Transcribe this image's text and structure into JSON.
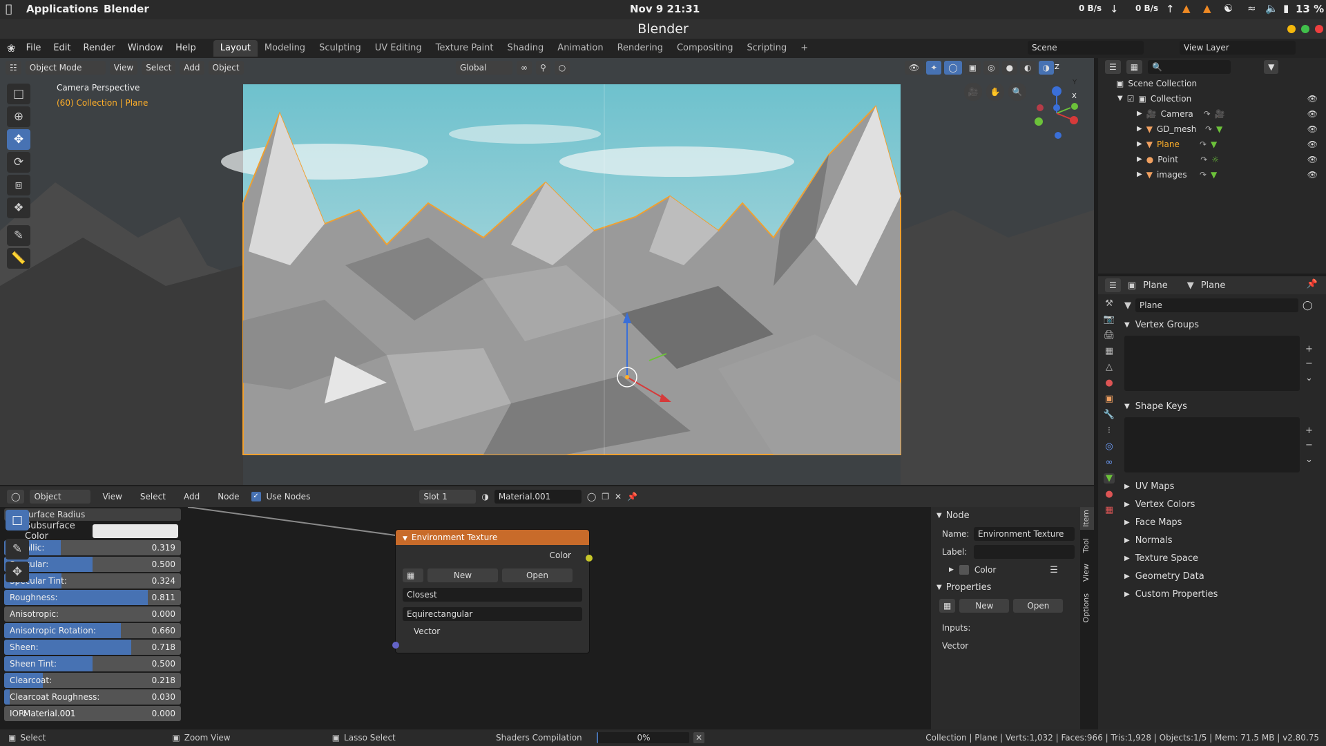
{
  "system": {
    "apps_label": "Applications",
    "app_name": "Blender",
    "datetime": "Nov 9  21:31",
    "net_down": "0 B/s",
    "net_up": "0 B/s",
    "battery": "13 %"
  },
  "window": {
    "title": "Blender"
  },
  "menu": {
    "items": [
      "File",
      "Edit",
      "Render",
      "Window",
      "Help"
    ],
    "workspaces": [
      "Layout",
      "Modeling",
      "Sculpting",
      "UV Editing",
      "Texture Paint",
      "Shading",
      "Animation",
      "Rendering",
      "Compositing",
      "Scripting"
    ],
    "active_workspace": "Layout",
    "add_tab": "+",
    "scene": "Scene",
    "view_layer": "View Layer"
  },
  "viewport": {
    "mode": "Object Mode",
    "menus": [
      "View",
      "Select",
      "Add",
      "Object"
    ],
    "orientation": "Global",
    "camera_label": "Camera Perspective",
    "collection_label": "(60) Collection | Plane",
    "gizmo": {
      "x": "X",
      "y": "Y",
      "z": "Z"
    }
  },
  "outliner": {
    "root": "Scene Collection",
    "collection": "Collection",
    "items": [
      {
        "name": "Camera",
        "active": false
      },
      {
        "name": "GD_mesh",
        "active": false
      },
      {
        "name": "Plane",
        "active": true
      },
      {
        "name": "Point",
        "active": false
      },
      {
        "name": "images",
        "active": false
      }
    ]
  },
  "properties": {
    "header_object": "Plane",
    "header_data": "Plane",
    "data_name": "Plane",
    "sections": {
      "vertex_groups": "Vertex Groups",
      "shape_keys": "Shape Keys"
    },
    "collapsed": [
      "UV Maps",
      "Vertex Colors",
      "Face Maps",
      "Normals",
      "Texture Space",
      "Geometry Data",
      "Custom Properties"
    ]
  },
  "node_editor": {
    "object_type": "Object",
    "menus": [
      "View",
      "Select",
      "Add",
      "Node"
    ],
    "use_nodes": "Use Nodes",
    "slot": "Slot 1",
    "material": "Material.001",
    "subsurface_radius": "Subsurface Radius",
    "subsurface_color": "Subsurface Color",
    "sliders": [
      {
        "label": "Metallic:",
        "value": "0.319",
        "frac": 0.319
      },
      {
        "label": "Specular:",
        "value": "0.500",
        "frac": 0.5
      },
      {
        "label": "Specular Tint:",
        "value": "0.324",
        "frac": 0.324
      },
      {
        "label": "Roughness:",
        "value": "0.811",
        "frac": 0.811
      },
      {
        "label": "Anisotropic:",
        "value": "0.000",
        "frac": 0
      },
      {
        "label": "Anisotropic Rotation:",
        "value": "0.660",
        "frac": 0.66
      },
      {
        "label": "Sheen:",
        "value": "0.718",
        "frac": 0.718
      },
      {
        "label": "Sheen Tint:",
        "value": "0.500",
        "frac": 0.5
      },
      {
        "label": "Clearcoat:",
        "value": "0.218",
        "frac": 0.218
      },
      {
        "label": "Clearcoat Roughness:",
        "value": "0.030",
        "frac": 0.03
      },
      {
        "label": "IOR:",
        "value": "0.000",
        "frac": 0
      }
    ],
    "node_label_overlay": "Material.001",
    "env_node": {
      "title": "Environment Texture",
      "output": "Color",
      "new": "New",
      "open": "Open",
      "interpolation": "Closest",
      "projection": "Equirectangular",
      "input": "Vector"
    },
    "sidebar": {
      "node_section": "Node",
      "name_label": "Name:",
      "name_value": "Environment Texture",
      "label_label": "Label:",
      "color_label": "Color",
      "properties_section": "Properties",
      "new": "New",
      "open": "Open",
      "inputs": "Inputs:",
      "vector": "Vector",
      "tabs": [
        "Item",
        "Tool",
        "View",
        "Options"
      ]
    }
  },
  "status": {
    "select": "Select",
    "zoom": "Zoom View",
    "lasso": "Lasso Select",
    "compilation": "Shaders Compilation",
    "progress": "0%",
    "stats": "Collection | Plane | Verts:1,032 | Faces:966 | Tris:1,928 | Objects:1/5 | Mem: 71.5 MB | v2.80.75"
  },
  "colors": {
    "accent": "#4772b3",
    "active_object": "#ffaf29",
    "node_header": "#c86b2a"
  }
}
